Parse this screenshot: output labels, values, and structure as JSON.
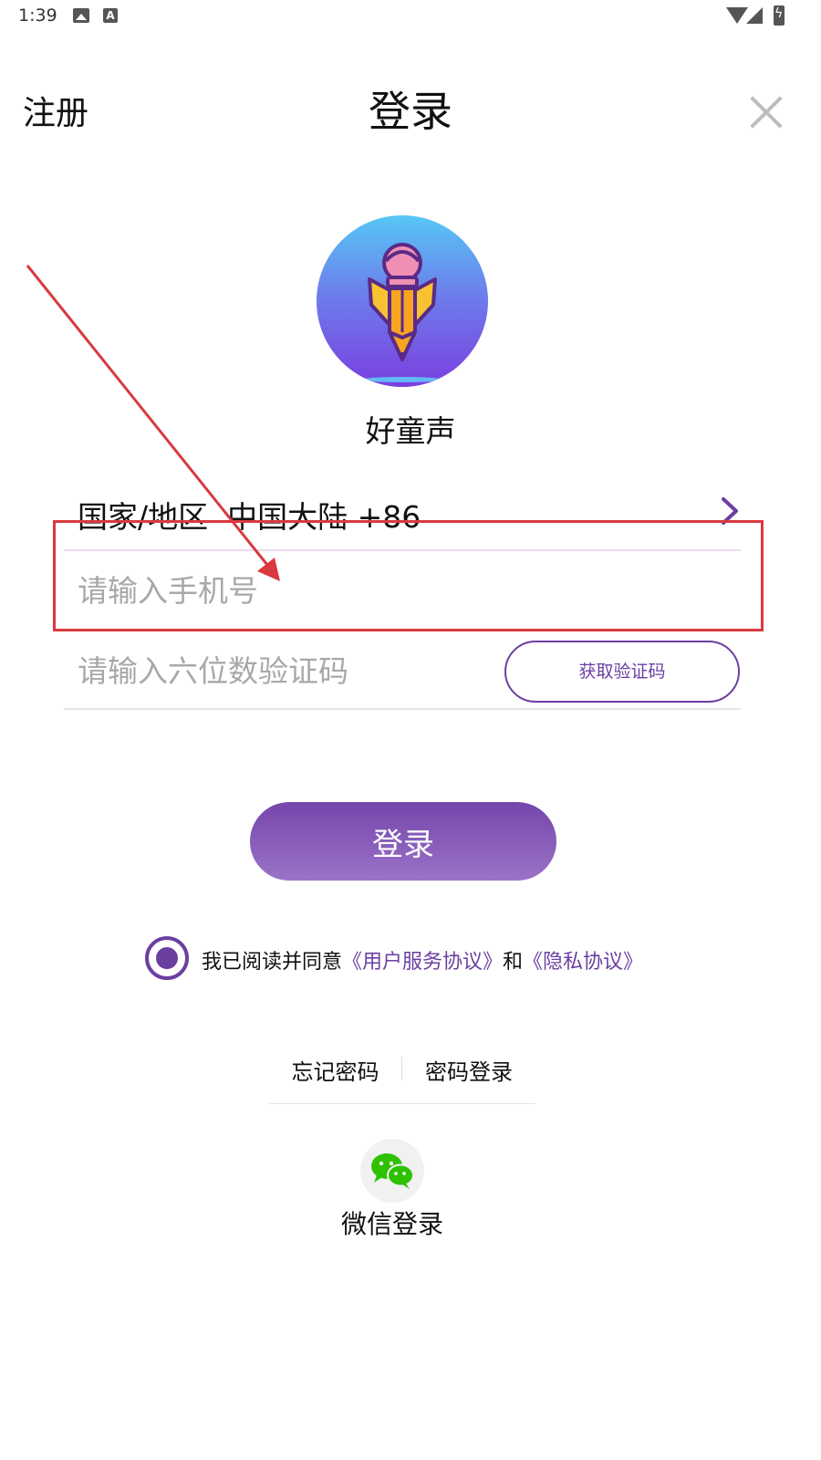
{
  "status_bar": {
    "time": "1:39",
    "icons": [
      "image-icon",
      "a-icon",
      "wifi-icon",
      "signal-icon",
      "battery-charging-icon"
    ]
  },
  "header": {
    "register_label": "注册",
    "title": "登录",
    "close_icon": "close-icon"
  },
  "app": {
    "name": "好童声",
    "logo_icon": "pencil-astronaut-logo"
  },
  "form": {
    "country_label": "国家/地区  中国大陆 +86",
    "phone_placeholder": "请输入手机号",
    "phone_value": "",
    "code_placeholder": "请输入六位数验证码",
    "code_value": "",
    "get_code_label": "获取验证码",
    "login_label": "登录"
  },
  "agreement": {
    "text_prefix": "我已阅读并同意",
    "user_agreement": "《用户服务协议》",
    "and": "和",
    "privacy_agreement": "《隐私协议》",
    "checked": true
  },
  "links": {
    "forgot_password": "忘记密码",
    "password_login": "密码登录"
  },
  "wechat": {
    "label": "微信登录"
  },
  "colors": {
    "accent": "#6b3fa0",
    "annotation": "#d9393f",
    "wechat_green": "#2dc100"
  }
}
